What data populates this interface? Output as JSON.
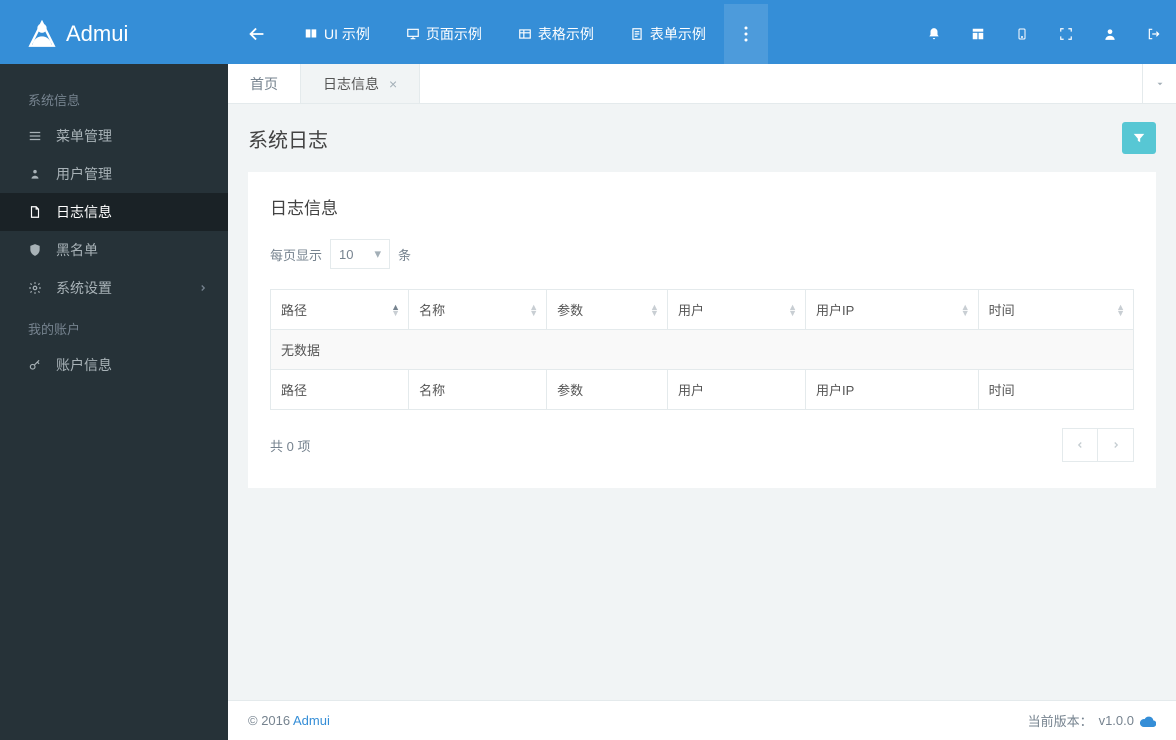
{
  "brand": "Admui",
  "topnav": {
    "items": [
      {
        "label": "UI 示例"
      },
      {
        "label": "页面示例"
      },
      {
        "label": "表格示例"
      },
      {
        "label": "表单示例"
      }
    ]
  },
  "sidebar": {
    "group1_title": "系统信息",
    "group2_title": "我的账户",
    "items1": [
      {
        "label": "菜单管理"
      },
      {
        "label": "用户管理"
      },
      {
        "label": "日志信息"
      },
      {
        "label": "黑名单"
      },
      {
        "label": "系统设置"
      }
    ],
    "items2": [
      {
        "label": "账户信息"
      }
    ]
  },
  "tabs": [
    {
      "label": "首页"
    },
    {
      "label": "日志信息"
    }
  ],
  "page": {
    "title": "系统日志",
    "panel_title": "日志信息",
    "len_prefix": "每页显示",
    "len_value": "10",
    "len_suffix": "条",
    "columns": [
      "路径",
      "名称",
      "参数",
      "用户",
      "用户IP",
      "时间"
    ],
    "empty_text": "无数据",
    "info_text": "共 0 项"
  },
  "footer": {
    "copyright": "© 2016 ",
    "brand_link": "Admui",
    "version_label": "当前版本：",
    "version": "v1.0.0"
  }
}
